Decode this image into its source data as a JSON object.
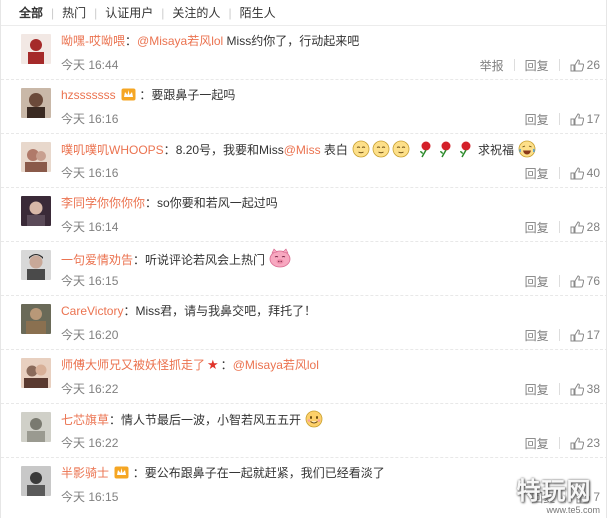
{
  "filter_tabs": [
    {
      "label": "全部",
      "active": true
    },
    {
      "label": "热门",
      "active": false
    },
    {
      "label": "认证用户",
      "active": false
    },
    {
      "label": "关注的人",
      "active": false
    },
    {
      "label": "陌生人",
      "active": false
    }
  ],
  "comments": [
    {
      "username": "呦嘿-哎呦喂",
      "separator": "：",
      "mention": "@Misaya若风lol",
      "text": " Miss约你了，行动起来吧",
      "time": "今天 16:44",
      "report_label": "举报",
      "reply_label": "回复",
      "likes": "26",
      "avatar_color": "#a52a2a"
    },
    {
      "username": "hzsssssss",
      "badge": "crown",
      "separator": "：",
      "text": "要跟鼻子一起吗",
      "time": "今天 16:16",
      "reply_label": "回复",
      "likes": "17",
      "avatar_color": "#6b4a3a"
    },
    {
      "username": "噗叽噗叽WHOOPS",
      "separator": "：",
      "text_before": "8.20号，我要和Miss",
      "mention": "@Miss",
      "text": " 表白",
      "emoticons": [
        "shy-face",
        "shy-face",
        "shy-face",
        "rose",
        "rose",
        "rose"
      ],
      "text_after": " 求祝福",
      "time": "今天 16:16",
      "reply_label": "回复",
      "likes": "40",
      "avatar_color": "#b07a6a"
    },
    {
      "username": "李同学你你你你",
      "separator": "：",
      "text": "so你要和若风一起过吗",
      "time": "今天 16:14",
      "reply_label": "回复",
      "likes": "28",
      "avatar_color": "#5a4a58"
    },
    {
      "username": "一句爱情劝告",
      "separator": "：",
      "text": "听说评论若风会上热门",
      "time": "今天 16:15",
      "reply_label": "回复",
      "likes": "76",
      "avatar_color": "#4a4a4a"
    },
    {
      "username": "CareVictory",
      "separator": "：",
      "text": "Miss君，请与我鼻交吧，拜托了！",
      "time": "今天 16:20",
      "reply_label": "回复",
      "likes": "17",
      "avatar_color": "#3a3a2a"
    },
    {
      "username": "师傅大师兄又被妖怪抓走了",
      "badge": "star",
      "separator": "：",
      "mention": "@Misaya若风lol",
      "text": "",
      "time": "今天 16:22",
      "reply_label": "回复",
      "likes": "38",
      "avatar_color": "#8a6a5a"
    },
    {
      "username": "七芯旗草",
      "separator": "：",
      "text": "情人节最后一波，小智若风五五开",
      "time": "今天 16:22",
      "reply_label": "回复",
      "likes": "23",
      "avatar_color": "#7a7a70"
    },
    {
      "username": "半影骑士",
      "badge": "crown",
      "separator": "：",
      "text": "要公布跟鼻子在一起就赶紧，我们已经看淡了",
      "time": "今天 16:15",
      "reply_label": "回复",
      "likes": "7",
      "avatar_color": "#3a3a3a"
    }
  ],
  "watermark": {
    "text": "特玩网",
    "url": "www.te5.com"
  },
  "colors": {
    "username": "#eb7350",
    "meta": "#808080",
    "text": "#333333"
  }
}
